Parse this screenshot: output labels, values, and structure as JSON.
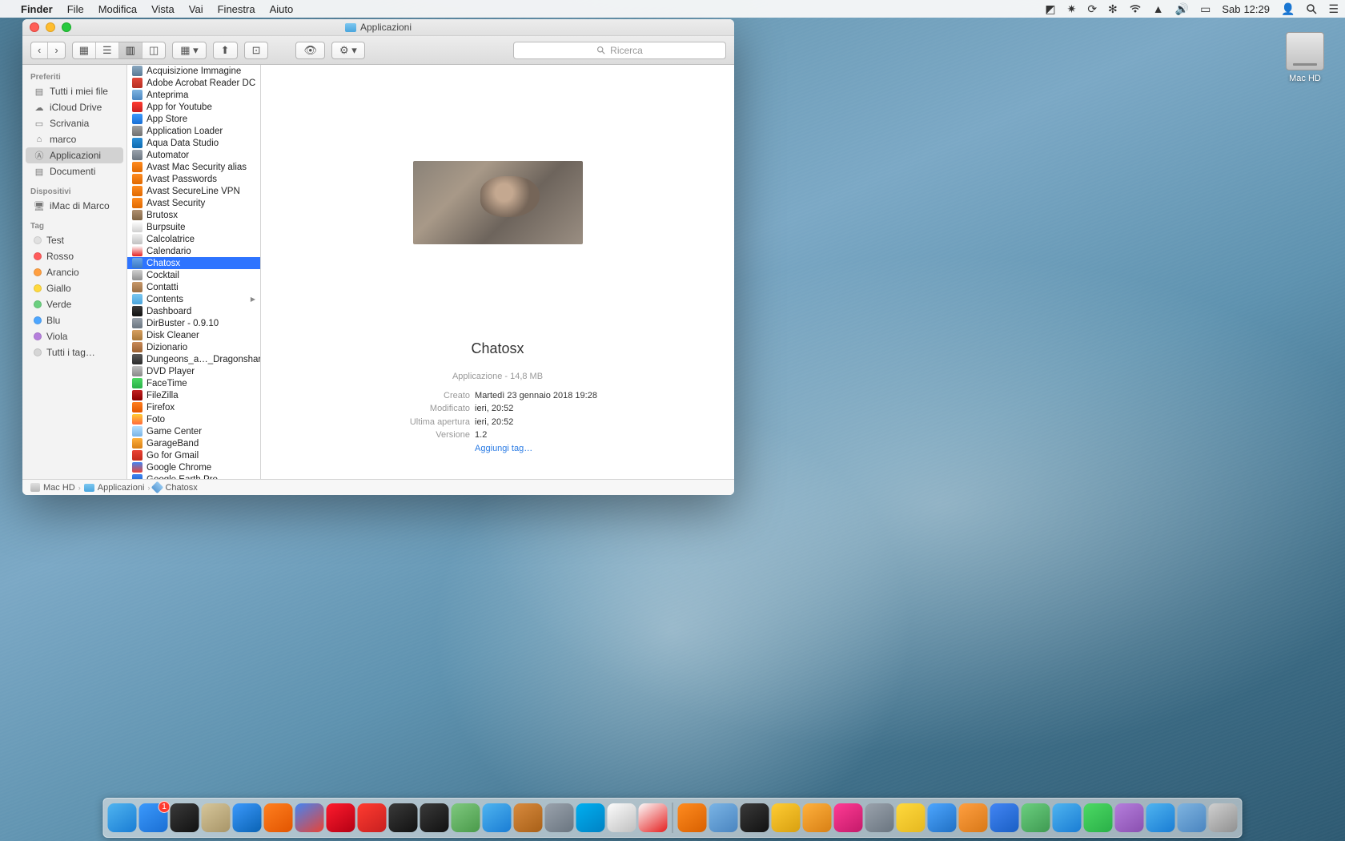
{
  "menubar": {
    "app": "Finder",
    "items": [
      "File",
      "Modifica",
      "Vista",
      "Vai",
      "Finestra",
      "Aiuto"
    ],
    "day": "Sab",
    "time": "12:29"
  },
  "desktop": {
    "hd_label": "Mac HD"
  },
  "finder": {
    "title": "Applicazioni",
    "search_placeholder": "Ricerca",
    "sidebar": {
      "favorites_head": "Preferiti",
      "favorites": [
        {
          "label": "Tutti i miei file",
          "icon": "files"
        },
        {
          "label": "iCloud Drive",
          "icon": "cloud"
        },
        {
          "label": "Scrivania",
          "icon": "desktop"
        },
        {
          "label": "marco",
          "icon": "home"
        },
        {
          "label": "Applicazioni",
          "icon": "apps",
          "selected": true
        },
        {
          "label": "Documenti",
          "icon": "docs"
        }
      ],
      "devices_head": "Dispositivi",
      "devices": [
        {
          "label": "iMac di Marco",
          "icon": "imac"
        }
      ],
      "tags_head": "Tag",
      "tags": [
        {
          "label": "Test",
          "color": "#e0e0e0"
        },
        {
          "label": "Rosso",
          "color": "#ff5b5b"
        },
        {
          "label": "Arancio",
          "color": "#ff9f40"
        },
        {
          "label": "Giallo",
          "color": "#ffd93d"
        },
        {
          "label": "Verde",
          "color": "#6bcf7f"
        },
        {
          "label": "Blu",
          "color": "#4da6ff"
        },
        {
          "label": "Viola",
          "color": "#b57edc"
        },
        {
          "label": "Tutti i tag…",
          "color": "#d5d5d5"
        }
      ]
    },
    "apps": [
      {
        "name": "Acquisizione Immagine",
        "c1": "#8aa8c0",
        "c2": "#5a7a95"
      },
      {
        "name": "Adobe Acrobat Reader DC",
        "c1": "#e2483a",
        "c2": "#b52e22"
      },
      {
        "name": "Anteprima",
        "c1": "#7fb4e0",
        "c2": "#4a85c0"
      },
      {
        "name": "App for Youtube",
        "c1": "#ff3b30",
        "c2": "#c82020"
      },
      {
        "name": "App Store",
        "c1": "#3b99fc",
        "c2": "#1a6fd4"
      },
      {
        "name": "Application Loader",
        "c1": "#a0a0a0",
        "c2": "#707070"
      },
      {
        "name": "Aqua Data Studio",
        "c1": "#2a8fd8",
        "c2": "#0c6ab0"
      },
      {
        "name": "Automator",
        "c1": "#9aa2ac",
        "c2": "#6a7580"
      },
      {
        "name": "Avast Mac Security alias",
        "c1": "#ff8b1f",
        "c2": "#e06800"
      },
      {
        "name": "Avast Passwords",
        "c1": "#ff8b1f",
        "c2": "#e06800"
      },
      {
        "name": "Avast SecureLine VPN",
        "c1": "#ff8b1f",
        "c2": "#e06800"
      },
      {
        "name": "Avast Security",
        "c1": "#ff8b1f",
        "c2": "#e06800"
      },
      {
        "name": "Brutosx",
        "c1": "#b09070",
        "c2": "#806545"
      },
      {
        "name": "Burpsuite",
        "c1": "#fcfcfc",
        "c2": "#d0d0d0"
      },
      {
        "name": "Calcolatrice",
        "c1": "#f0f0f0",
        "c2": "#c0c0c0"
      },
      {
        "name": "Calendario",
        "c1": "#fcfcfc",
        "c2": "#e52020"
      },
      {
        "name": "Chatosx",
        "c1": "#6aa6e8",
        "c2": "#3a78c5",
        "selected": true
      },
      {
        "name": "Cocktail",
        "c1": "#d0d0d0",
        "c2": "#909090"
      },
      {
        "name": "Contatti",
        "c1": "#c8986a",
        "c2": "#9a6f45"
      },
      {
        "name": "Contents",
        "c1": "#7cc7f0",
        "c2": "#4aa5dd",
        "folder": true,
        "arrow": true
      },
      {
        "name": "Dashboard",
        "c1": "#3a3a3a",
        "c2": "#111"
      },
      {
        "name": "DirBuster - 0.9.10",
        "c1": "#9aa2ac",
        "c2": "#6a7580"
      },
      {
        "name": "Disk Cleaner",
        "c1": "#d8a060",
        "c2": "#a87738"
      },
      {
        "name": "Dizionario",
        "c1": "#c88a58",
        "c2": "#9a6030"
      },
      {
        "name": "Dungeons_a…_Dragonshard",
        "c1": "#5a5a5a",
        "c2": "#2a2a2a"
      },
      {
        "name": "DVD Player",
        "c1": "#c0c0c0",
        "c2": "#888"
      },
      {
        "name": "FaceTime",
        "c1": "#4cd964",
        "c2": "#2ab048"
      },
      {
        "name": "FileZilla",
        "c1": "#c22020",
        "c2": "#8a0000"
      },
      {
        "name": "Firefox",
        "c1": "#ff7f1f",
        "c2": "#e25500"
      },
      {
        "name": "Foto",
        "c1": "#ffcc33",
        "c2": "#ff6a3d"
      },
      {
        "name": "Game Center",
        "c1": "#b5e0ff",
        "c2": "#7ab4e5"
      },
      {
        "name": "GarageBand",
        "c1": "#ffb13d",
        "c2": "#d88015"
      },
      {
        "name": "Go for Gmail",
        "c1": "#ea4335",
        "c2": "#c22a1c"
      },
      {
        "name": "Google Chrome",
        "c1": "#4285f4",
        "c2": "#ea4335"
      },
      {
        "name": "Google Earth Pro",
        "c1": "#4285f4",
        "c2": "#0f5ab4"
      }
    ],
    "preview": {
      "title": "Chatosx",
      "subtitle": "Applicazione - 14,8 MB",
      "rows": [
        {
          "label": "Creato",
          "value": "Martedì 23 gennaio 2018 19:28"
        },
        {
          "label": "Modificato",
          "value": "ieri, 20:52"
        },
        {
          "label": "Ultima apertura",
          "value": "ieri, 20:52"
        },
        {
          "label": "Versione",
          "value": "1.2"
        }
      ],
      "add_tags": "Aggiungi tag…"
    },
    "pathbar": [
      {
        "label": "Mac HD",
        "type": "hd"
      },
      {
        "label": "Applicazioni",
        "type": "folder"
      },
      {
        "label": "Chatosx",
        "type": "app"
      }
    ]
  },
  "dock": {
    "badge_count": "1",
    "items": [
      {
        "name": "finder",
        "c1": "#4fb4f0",
        "c2": "#1a7dd4"
      },
      {
        "name": "appstore",
        "c1": "#3b99fc",
        "c2": "#1a6fd4",
        "badge": true
      },
      {
        "name": "activity",
        "c1": "#3a3a3a",
        "c2": "#111"
      },
      {
        "name": "print",
        "c1": "#d6c69a",
        "c2": "#a89568"
      },
      {
        "name": "safari",
        "c1": "#3b99fc",
        "c2": "#0a63b4"
      },
      {
        "name": "firefox",
        "c1": "#ff7f1f",
        "c2": "#e25500"
      },
      {
        "name": "chrome",
        "c1": "#4285f4",
        "c2": "#ea4335"
      },
      {
        "name": "opera",
        "c1": "#ff1b2d",
        "c2": "#b40014"
      },
      {
        "name": "hand",
        "c1": "#ff3b30",
        "c2": "#c82020"
      },
      {
        "name": "terminal",
        "c1": "#3a3a3a",
        "c2": "#111"
      },
      {
        "name": "terminal2",
        "c1": "#3a3a3a",
        "c2": "#111"
      },
      {
        "name": "app1",
        "c1": "#7fc97f",
        "c2": "#4a9a4a"
      },
      {
        "name": "messages",
        "c1": "#4fb4f0",
        "c2": "#1a7dd4"
      },
      {
        "name": "app2",
        "c1": "#d88a3d",
        "c2": "#a86018"
      },
      {
        "name": "app3",
        "c1": "#9aa2ac",
        "c2": "#6a7580"
      },
      {
        "name": "skype",
        "c1": "#00aff0",
        "c2": "#0082c4"
      },
      {
        "name": "cards",
        "c1": "#fcfcfc",
        "c2": "#c0c0c0"
      },
      {
        "name": "calendar",
        "c1": "#fcfcfc",
        "c2": "#e52020"
      },
      {
        "name": "sep"
      },
      {
        "name": "vlc",
        "c1": "#ff8b1f",
        "c2": "#d86000"
      },
      {
        "name": "app4",
        "c1": "#7ab4e5",
        "c2": "#4a85c0"
      },
      {
        "name": "app5",
        "c1": "#3a3a3a",
        "c2": "#111"
      },
      {
        "name": "star",
        "c1": "#ffcc33",
        "c2": "#d8a010"
      },
      {
        "name": "garageband",
        "c1": "#ffb13d",
        "c2": "#d88015"
      },
      {
        "name": "itunes",
        "c1": "#ff3b94",
        "c2": "#c41a6a"
      },
      {
        "name": "app6",
        "c1": "#9aa2ac",
        "c2": "#6a7580"
      },
      {
        "name": "notes",
        "c1": "#ffd93d",
        "c2": "#e5b820"
      },
      {
        "name": "focus",
        "c1": "#4da6ff",
        "c2": "#2070c4"
      },
      {
        "name": "pages",
        "c1": "#ff9f40",
        "c2": "#d87818"
      },
      {
        "name": "doc",
        "c1": "#4285f4",
        "c2": "#1a5fc4"
      },
      {
        "name": "app7",
        "c1": "#6bcf7f",
        "c2": "#3f9a52"
      },
      {
        "name": "users",
        "c1": "#4fb4f0",
        "c2": "#1a7dd4"
      },
      {
        "name": "numbers",
        "c1": "#4cd964",
        "c2": "#2ab048"
      },
      {
        "name": "app8",
        "c1": "#b57edc",
        "c2": "#8a50b0"
      },
      {
        "name": "keynote",
        "c1": "#4fb4f0",
        "c2": "#1a7dd4"
      },
      {
        "name": "preview",
        "c1": "#7fb4e0",
        "c2": "#4a85c0"
      },
      {
        "name": "trash",
        "c1": "#d0d0d0",
        "c2": "#909090"
      }
    ]
  }
}
